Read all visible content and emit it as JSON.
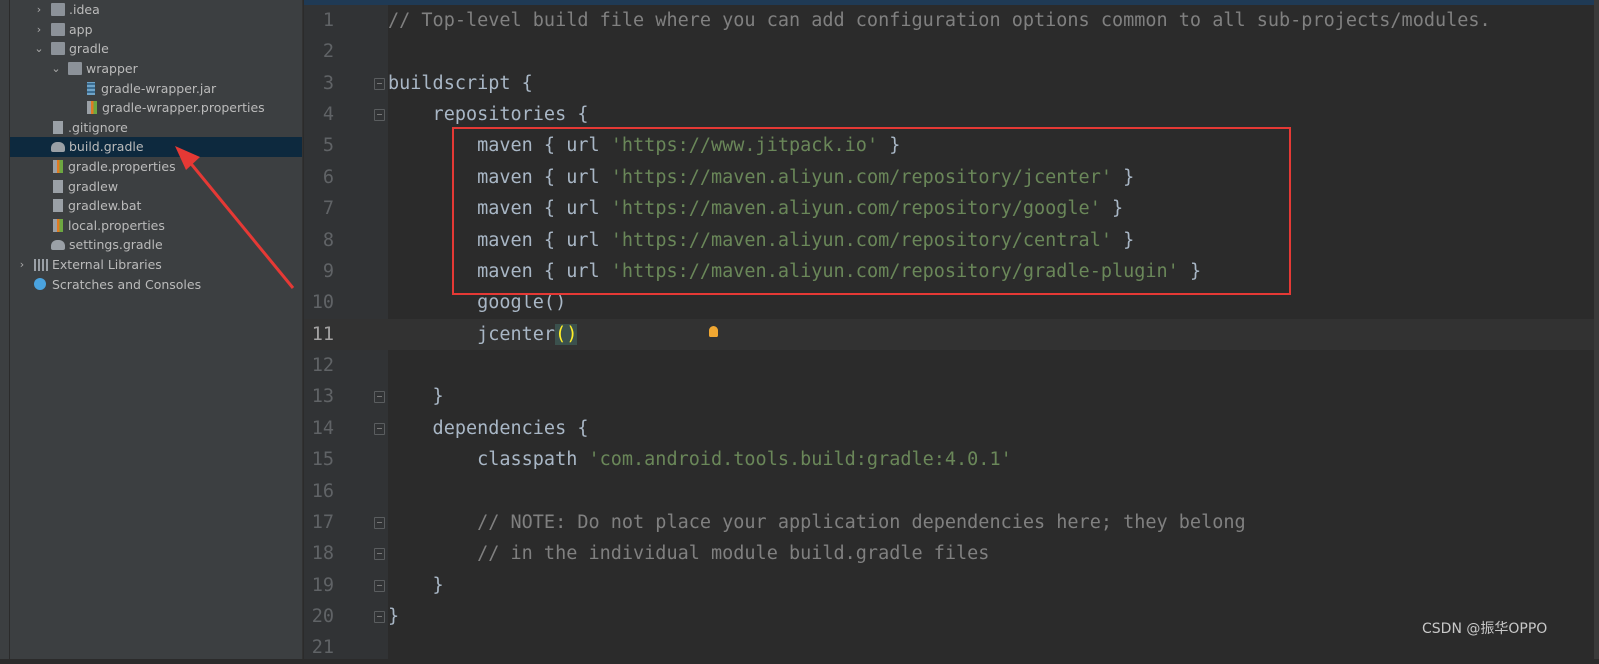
{
  "project_tree": [
    {
      "label": ".idea",
      "type": "folder",
      "depth": 1,
      "expander": "collapsed"
    },
    {
      "label": "app",
      "type": "folder",
      "depth": 1,
      "expander": "collapsed"
    },
    {
      "label": "gradle",
      "type": "folder",
      "depth": 1,
      "expander": "expanded"
    },
    {
      "label": "wrapper",
      "type": "folder",
      "depth": 2,
      "expander": "expanded"
    },
    {
      "label": "gradle-wrapper.jar",
      "type": "jar",
      "depth": 3
    },
    {
      "label": "gradle-wrapper.properties",
      "type": "properties",
      "depth": 3
    },
    {
      "label": ".gitignore",
      "type": "ignore",
      "depth": 1
    },
    {
      "label": "build.gradle",
      "type": "gradle",
      "depth": 1,
      "selected": true
    },
    {
      "label": "gradle.properties",
      "type": "properties",
      "depth": 1
    },
    {
      "label": "gradlew",
      "type": "shell",
      "depth": 1
    },
    {
      "label": "gradlew.bat",
      "type": "text",
      "depth": 1
    },
    {
      "label": "local.properties",
      "type": "properties",
      "depth": 1
    },
    {
      "label": "settings.gradle",
      "type": "gradle",
      "depth": 1
    },
    {
      "label": "External Libraries",
      "type": "libraries",
      "depth": 0,
      "expander": "collapsed"
    },
    {
      "label": "Scratches and Consoles",
      "type": "scratches",
      "depth": 0
    }
  ],
  "editor": {
    "current_line": 11,
    "lines": [
      {
        "n": "1",
        "parts": [
          [
            "cm",
            "// Top-level build file where you can add configuration options common to all sub-projects/modules."
          ]
        ]
      },
      {
        "n": "2",
        "parts": []
      },
      {
        "n": "3",
        "parts": [
          [
            "",
            "buildscript {"
          ]
        ],
        "fold": true
      },
      {
        "n": "4",
        "parts": [
          [
            "",
            "    repositories {"
          ]
        ],
        "fold": true
      },
      {
        "n": "5",
        "parts": [
          [
            "",
            "        maven { url "
          ],
          [
            "str",
            "'https://www.jitpack.io'"
          ],
          [
            "",
            " }"
          ]
        ]
      },
      {
        "n": "6",
        "parts": [
          [
            "",
            "        maven { url "
          ],
          [
            "str",
            "'https://maven.aliyun.com/repository/jcenter'"
          ],
          [
            "",
            " }"
          ]
        ]
      },
      {
        "n": "7",
        "parts": [
          [
            "",
            "        maven { url "
          ],
          [
            "str",
            "'https://maven.aliyun.com/repository/google'"
          ],
          [
            "",
            " }"
          ]
        ]
      },
      {
        "n": "8",
        "parts": [
          [
            "",
            "        maven { url "
          ],
          [
            "str",
            "'https://maven.aliyun.com/repository/central'"
          ],
          [
            "",
            " }"
          ]
        ]
      },
      {
        "n": "9",
        "parts": [
          [
            "",
            "        maven { url "
          ],
          [
            "str",
            "'https://maven.aliyun.com/repository/gradle-plugin'"
          ],
          [
            "",
            " }"
          ]
        ]
      },
      {
        "n": "10",
        "parts": [
          [
            "",
            "        google()"
          ]
        ]
      },
      {
        "n": "11",
        "parts": [
          [
            "",
            "        jcenter"
          ],
          [
            "brk",
            "()"
          ]
        ]
      },
      {
        "n": "12",
        "parts": []
      },
      {
        "n": "13",
        "parts": [
          [
            "",
            "    }"
          ]
        ],
        "fold": true
      },
      {
        "n": "14",
        "parts": [
          [
            "",
            "    dependencies {"
          ]
        ],
        "fold": true
      },
      {
        "n": "15",
        "parts": [
          [
            "",
            "        classpath "
          ],
          [
            "str",
            "'com.android.tools.build:gradle:4.0.1'"
          ]
        ]
      },
      {
        "n": "16",
        "parts": []
      },
      {
        "n": "17",
        "parts": [
          [
            "cm",
            "        // NOTE: Do not place your application dependencies here; they belong"
          ]
        ],
        "fold": true
      },
      {
        "n": "18",
        "parts": [
          [
            "cm",
            "        // in the individual module build.gradle files"
          ]
        ],
        "fold": true
      },
      {
        "n": "19",
        "parts": [
          [
            "",
            "    }"
          ]
        ],
        "fold": true
      },
      {
        "n": "20",
        "parts": [
          [
            "",
            "}"
          ]
        ],
        "fold": true
      },
      {
        "n": "21",
        "parts": []
      }
    ]
  },
  "annotation": {
    "color": "#e53935"
  },
  "watermark": "CSDN @振华OPPO"
}
